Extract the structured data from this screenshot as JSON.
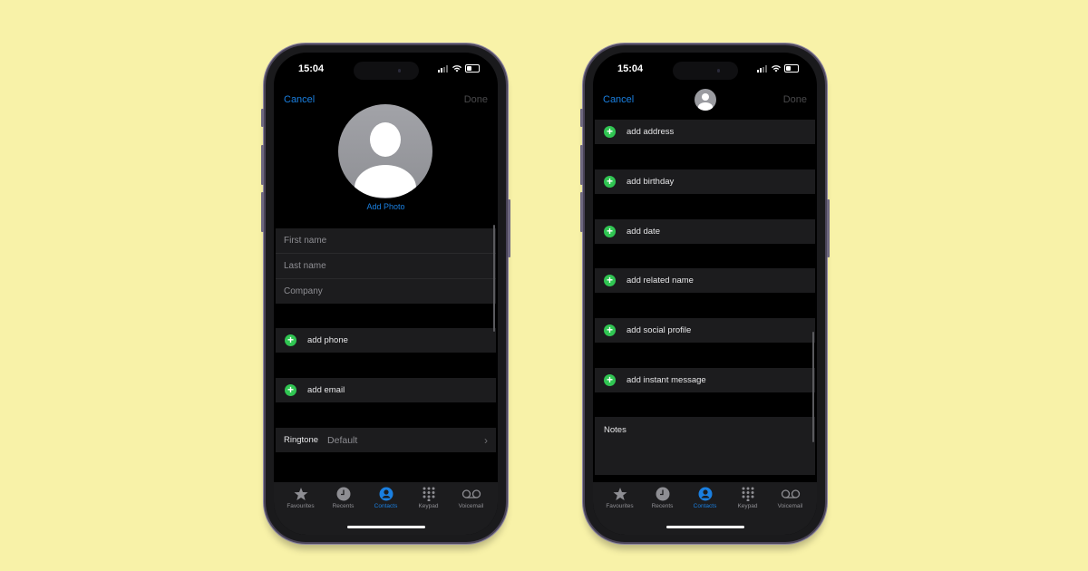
{
  "status_bar": {
    "time": "15:04"
  },
  "left_screen": {
    "nav": {
      "cancel": "Cancel",
      "done": "Done"
    },
    "add_photo": "Add Photo",
    "name_fields": [
      {
        "placeholder": "First name"
      },
      {
        "placeholder": "Last name"
      },
      {
        "placeholder": "Company"
      }
    ],
    "add_rows": [
      {
        "label": "add phone"
      },
      {
        "label": "add email"
      }
    ],
    "ringtone": {
      "label": "Ringtone",
      "value": "Default"
    }
  },
  "right_screen": {
    "nav": {
      "cancel": "Cancel",
      "done": "Done"
    },
    "add_rows": [
      {
        "label": "add address"
      },
      {
        "label": "add birthday"
      },
      {
        "label": "add date"
      },
      {
        "label": "add related name"
      },
      {
        "label": "add social profile"
      },
      {
        "label": "add instant message"
      }
    ],
    "notes_label": "Notes"
  },
  "tab_bar": {
    "tabs": [
      {
        "label": "Favourites",
        "icon": "star-icon"
      },
      {
        "label": "Recents",
        "icon": "clock-icon"
      },
      {
        "label": "Contacts",
        "icon": "person-circle-icon",
        "active": true
      },
      {
        "label": "Keypad",
        "icon": "keypad-icon"
      },
      {
        "label": "Voicemail",
        "icon": "voicemail-icon"
      }
    ]
  },
  "colors": {
    "background": "#f8f2a8",
    "accent_blue": "#1a7fe0",
    "add_green": "#30c552"
  }
}
